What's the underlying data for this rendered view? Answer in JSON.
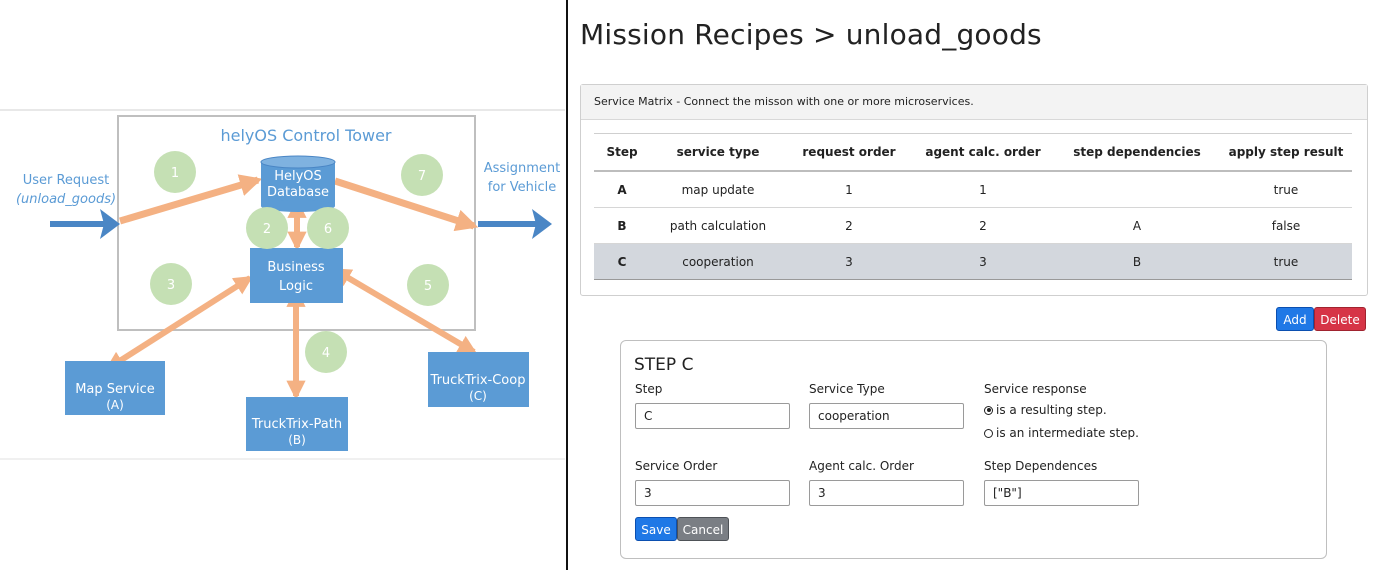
{
  "diagram": {
    "title": "helyOS Control Tower",
    "user_request_line1": "User Request",
    "user_request_line2": "(unload_goods)",
    "assignment_line1": "Assignment",
    "assignment_line2": "for Vehicle",
    "database_line1": "HelyOS",
    "database_line2": "Database",
    "business_line1": "Business",
    "business_line2": "Logic",
    "map_service_line1": "Map Service",
    "map_service_line2": "(A)",
    "path_line1": "TruckTrix-Path",
    "path_line2": "(B)",
    "coop_line1": "TruckTrix-Coop",
    "coop_line2": "(C)",
    "steps": [
      "1",
      "2",
      "3",
      "4",
      "5",
      "6",
      "7"
    ],
    "colors": {
      "box": "#5b9bd5",
      "arrow": "#f4b183",
      "circle": "#c5e0b4",
      "frame": "#bfbfbf",
      "title": "#5b9bd5",
      "flow_arrow": "#4a86c5"
    }
  },
  "panel": {
    "title": "Mission Recipes > unload_goods",
    "service_matrix": {
      "header": "Service Matrix - Connect the misson with one or more microservices.",
      "columns": [
        "Step",
        "service type",
        "request order",
        "agent calc. order",
        "step dependencies",
        "apply step result"
      ],
      "rows": [
        [
          "A",
          "map update",
          "1",
          "1",
          "",
          "true"
        ],
        [
          "B",
          "path calculation",
          "2",
          "2",
          "A",
          "false"
        ],
        [
          "C",
          "cooperation",
          "3",
          "3",
          "B",
          "true"
        ]
      ],
      "selected_row": "C"
    },
    "add_label": "Add",
    "delete_label": "Delete",
    "step_form": {
      "title": "STEP C",
      "step_label": "Step",
      "step_value": "C",
      "service_type_label": "Service Type",
      "service_type_value": "cooperation",
      "service_response_label": "Service response",
      "radio_resulting": "is a resulting step.",
      "radio_intermediate": "is an intermediate step.",
      "selected_response": "resulting",
      "service_order_label": "Service Order",
      "service_order_value": "3",
      "agent_order_label": "Agent calc. Order",
      "agent_order_value": "3",
      "step_dep_label": "Step Dependences",
      "step_dep_value": "[\"B\"]",
      "save_label": "Save",
      "cancel_label": "Cancel"
    }
  }
}
